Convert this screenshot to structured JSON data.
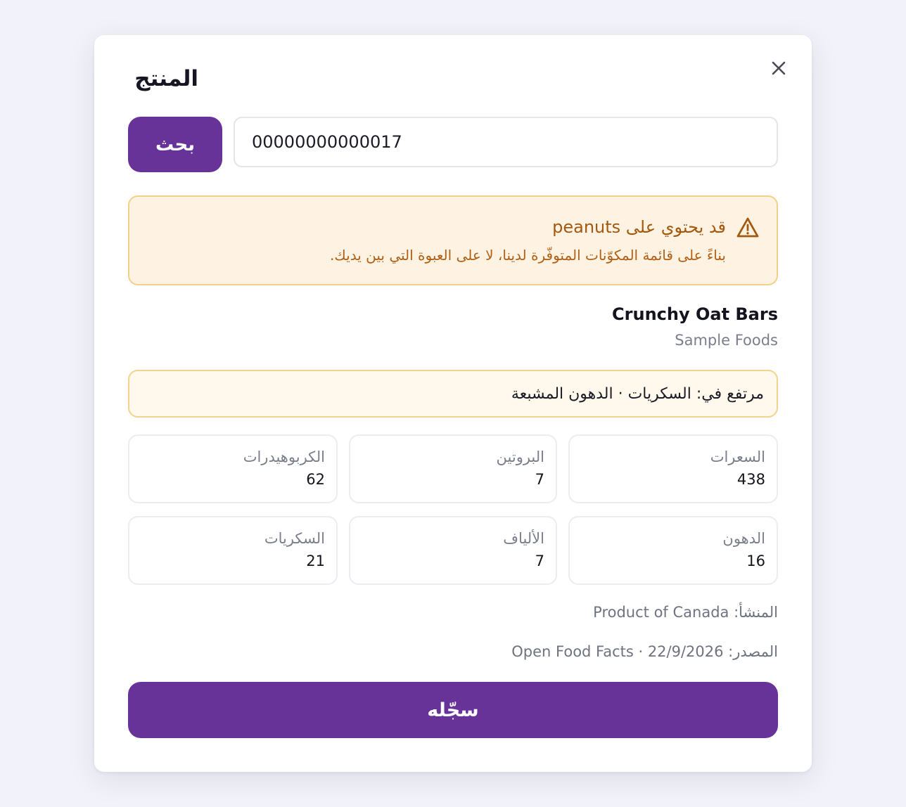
{
  "modal": {
    "title": "المنتج",
    "close_icon": "close-icon"
  },
  "search": {
    "button_label": "بحث",
    "input_value": "00000000000017"
  },
  "allergen_alert": {
    "icon": "warning-triangle-icon",
    "title": "قد يحتوي على peanuts",
    "description": "بناءً على قائمة المكوّنات المتوفّرة لدينا، لا على العبوة التي بين يديك."
  },
  "product": {
    "name": "Crunchy Oat Bars",
    "brand": "Sample Foods",
    "high_in": "مرتفع في: السكريات · الدهون المشبعة",
    "origin": "المنشأ: Product of Canada",
    "source": "المصدر: Open Food Facts · 22/9/2026"
  },
  "nutrients": [
    {
      "label": "السعرات",
      "value": "438"
    },
    {
      "label": "البروتين",
      "value": "7"
    },
    {
      "label": "الكربوهيدرات",
      "value": "62"
    },
    {
      "label": "الدهون",
      "value": "16"
    },
    {
      "label": "الألياف",
      "value": "7"
    },
    {
      "label": "السكريات",
      "value": "21"
    }
  ],
  "actions": {
    "log_label": "سجّله"
  },
  "colors": {
    "primary": "#673399",
    "warning_bg": "#fef3e2",
    "warning_border": "#f1d08a",
    "warning_text": "#a3580d"
  }
}
